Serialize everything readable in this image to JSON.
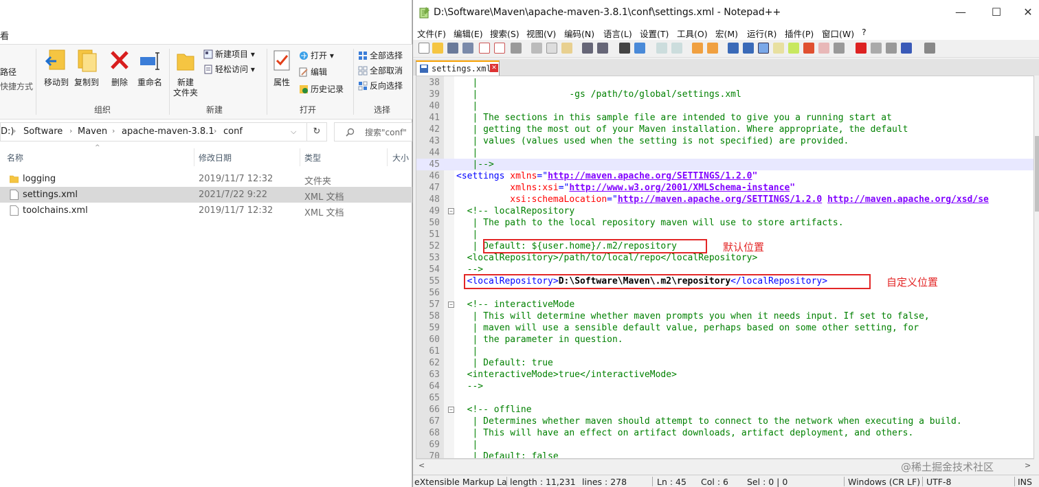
{
  "explorer": {
    "view_tab": "看",
    "ribbon": {
      "left_items": [
        "路径",
        "快捷方式"
      ],
      "move_to": "移动到",
      "copy_to": "复制到",
      "delete": "删除",
      "rename": "重命名",
      "organize_label": "组织",
      "new_folder_line1": "新建",
      "new_folder_line2": "文件夹",
      "new_item": "新建项目",
      "easy_access": "轻松访问",
      "new_label": "新建",
      "properties": "属性",
      "open": "打开",
      "edit": "编辑",
      "history": "历史记录",
      "open_label": "打开",
      "select_all": "全部选择",
      "select_none": "全部取消",
      "invert_selection": "反向选择",
      "select_label": "选择"
    },
    "address": {
      "drive": "D:)",
      "crumbs": [
        "Software",
        "Maven",
        "apache-maven-3.8.1",
        "conf"
      ]
    },
    "search_placeholder": "搜索\"conf\"",
    "columns": [
      "名称",
      "修改日期",
      "类型",
      "大小"
    ],
    "files": [
      {
        "name": "logging",
        "date": "2019/11/7 12:32",
        "type": "文件夹",
        "kind": "folder"
      },
      {
        "name": "settings.xml",
        "date": "2021/7/22 9:22",
        "type": "XML 文档",
        "kind": "file"
      },
      {
        "name": "toolchains.xml",
        "date": "2019/11/7 12:32",
        "type": "XML 文档",
        "kind": "file"
      }
    ]
  },
  "npp": {
    "title": "D:\\Software\\Maven\\apache-maven-3.8.1\\conf\\settings.xml - Notepad++",
    "menu": [
      "文件(F)",
      "编辑(E)",
      "搜索(S)",
      "视图(V)",
      "编码(N)",
      "语言(L)",
      "设置(T)",
      "工具(O)",
      "宏(M)",
      "运行(R)",
      "插件(P)",
      "窗口(W)",
      "?"
    ],
    "tab_name": "settings.xml",
    "lines": {
      "l38": {
        "n": "38",
        "a": "   |"
      },
      "l39": {
        "n": "39",
        "a": "   |                 -gs /path/to/global/settings.xml"
      },
      "l40": {
        "n": "40",
        "a": "   |"
      },
      "l41": {
        "n": "41",
        "a": "   | The sections in this sample file are intended to give you a running start at"
      },
      "l42": {
        "n": "42",
        "a": "   | getting the most out of your Maven installation. Where appropriate, the default"
      },
      "l43": {
        "n": "43",
        "a": "   | values (values used when the setting is not specified) are provided."
      },
      "l44": {
        "n": "44",
        "a": "   |"
      },
      "l45": {
        "n": "45",
        "a": "   |-->"
      },
      "l46": {
        "n": "46",
        "a": "<settings",
        "b": " xmlns",
        "c": "=\"",
        "d": "http://maven.apache.org/SETTINGS/1.2.0",
        "e": "\""
      },
      "l47": {
        "n": "47",
        "a": "          xmlns:xsi",
        "c": "=\"",
        "d": "http://www.w3.org/2001/XMLSchema-instance",
        "e": "\""
      },
      "l48": {
        "n": "48",
        "a": "          xsi:schemaLocation",
        "c": "=\"",
        "d": "http://maven.apache.org/SETTINGS/1.2.0",
        "f": "http://maven.apache.org/xsd/se"
      },
      "l49": {
        "n": "49",
        "a": "  <!-- localRepository"
      },
      "l50": {
        "n": "50",
        "a": "   | The path to the local repository maven will use to store artifacts."
      },
      "l51": {
        "n": "51",
        "a": "   |"
      },
      "l52": {
        "n": "52",
        "a": "   | Default: ${user.home}/.m2/repository"
      },
      "l53": {
        "n": "53",
        "a": "  <localRepository>/path/to/local/repo</localRepository>"
      },
      "l54": {
        "n": "54",
        "a": "  -->"
      },
      "l55": {
        "n": "55",
        "a": "  <localRepository>",
        "b": "D:\\Software\\Maven\\.m2\\repository",
        "c": "</localRepository>"
      },
      "l56": {
        "n": "56",
        "a": ""
      },
      "l57": {
        "n": "57",
        "a": "  <!-- interactiveMode"
      },
      "l58": {
        "n": "58",
        "a": "   | This will determine whether maven prompts you when it needs input. If set to false,"
      },
      "l59": {
        "n": "59",
        "a": "   | maven will use a sensible default value, perhaps based on some other setting, for"
      },
      "l60": {
        "n": "60",
        "a": "   | the parameter in question."
      },
      "l61": {
        "n": "61",
        "a": "   |"
      },
      "l62": {
        "n": "62",
        "a": "   | Default: true"
      },
      "l63": {
        "n": "63",
        "a": "  <interactiveMode>true</interactiveMode>"
      },
      "l64": {
        "n": "64",
        "a": "  -->"
      },
      "l65": {
        "n": "65",
        "a": ""
      },
      "l66": {
        "n": "66",
        "a": "  <!-- offline"
      },
      "l67": {
        "n": "67",
        "a": "   | Determines whether maven should attempt to connect to the network when executing a build."
      },
      "l68": {
        "n": "68",
        "a": "   | This will have an effect on artifact downloads, artifact deployment, and others."
      },
      "l69": {
        "n": "69",
        "a": "   |"
      },
      "l70": {
        "n": "70",
        "a": "   | Default: false"
      }
    },
    "annotations": {
      "default_location": "默认位置",
      "custom_location": "自定义位置"
    },
    "status": {
      "lang": "eXtensible Markup La",
      "length": "length : 11,231",
      "lines": "lines : 278",
      "ln": "Ln : 45",
      "col": "Col : 6",
      "sel": "Sel : 0 | 0",
      "eol": "Windows (CR LF)",
      "enc": "UTF-8",
      "mode": "INS"
    },
    "watermark": "@稀土掘金技术社区"
  }
}
